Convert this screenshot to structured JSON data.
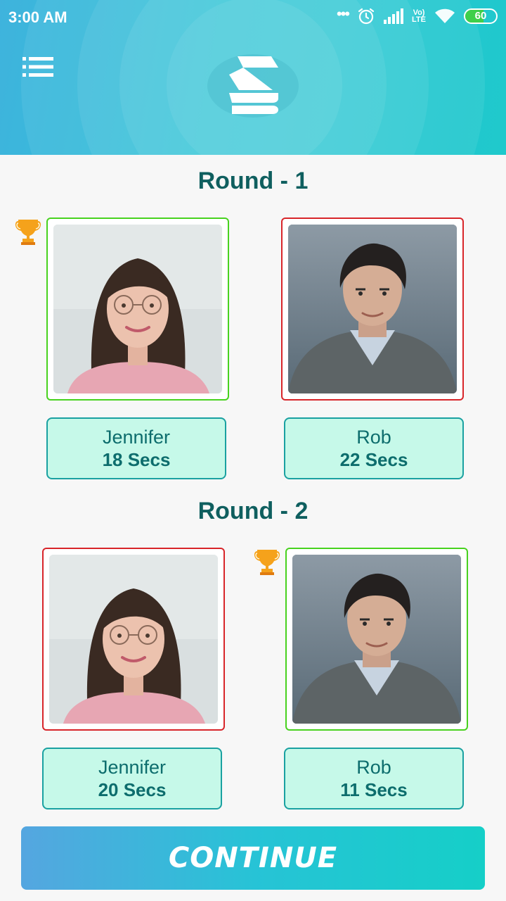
{
  "status_bar": {
    "time": "3:00 AM",
    "network": "LTE",
    "battery": "60",
    "battery_level": 0.6
  },
  "header": {
    "menu_icon": "list-icon",
    "logo_icon": "app-logo-icon"
  },
  "rounds": [
    {
      "title": "Round - 1",
      "players": [
        {
          "name": "Jennifer",
          "time": "18 Secs",
          "winner": true
        },
        {
          "name": "Rob",
          "time": "22 Secs",
          "winner": false
        }
      ]
    },
    {
      "title": "Round - 2",
      "players": [
        {
          "name": "Jennifer",
          "time": "20 Secs",
          "winner": false
        },
        {
          "name": "Rob",
          "time": "11 Secs",
          "winner": true
        }
      ]
    }
  ],
  "continue_label": "CONTINUE",
  "colors": {
    "winner_border": "#48d21f",
    "loser_border": "#d8252a",
    "title": "#0f5f5f",
    "card_bg": "#c6f9e9"
  }
}
